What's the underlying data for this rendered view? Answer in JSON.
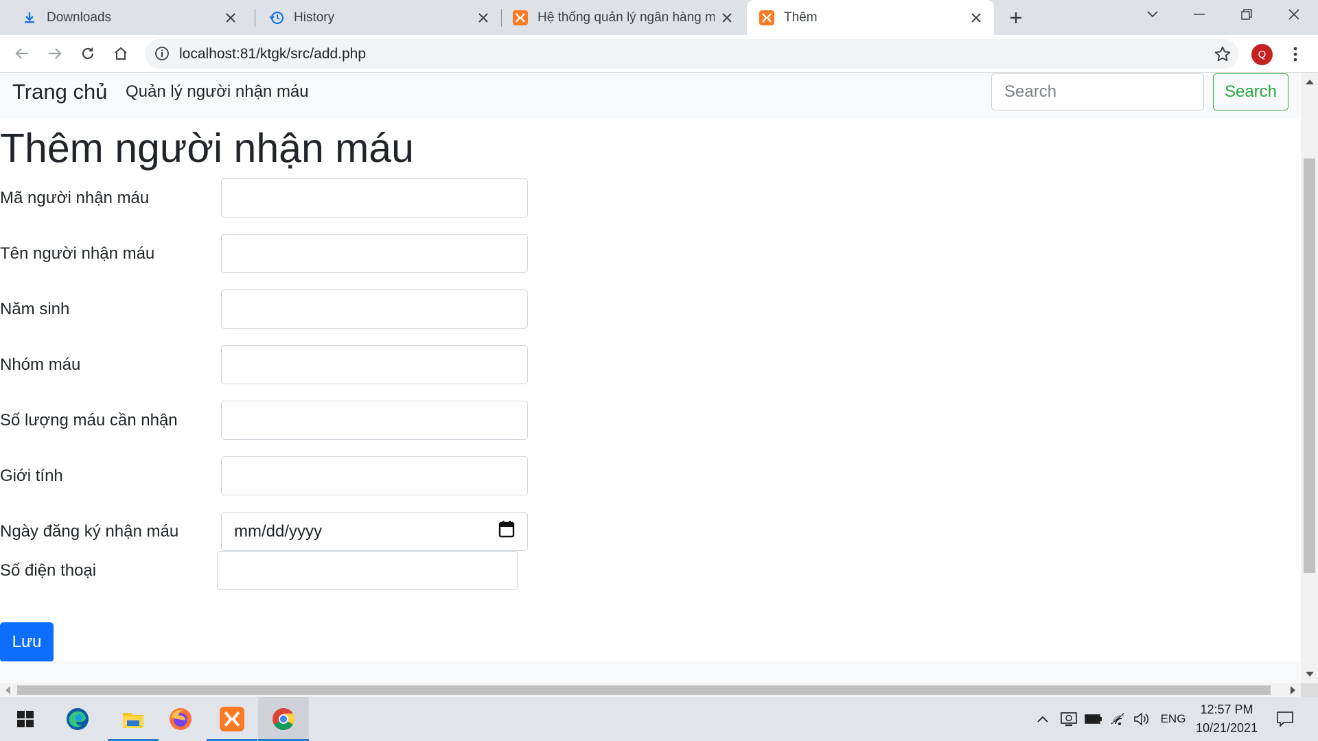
{
  "browser": {
    "tabs": [
      {
        "title": "Downloads",
        "icon": "download-icon"
      },
      {
        "title": "History",
        "icon": "history-icon"
      },
      {
        "title": "Hệ thống quản lý ngân hàng máu",
        "icon": "xampp-icon"
      },
      {
        "title": "Thêm",
        "icon": "xampp-icon",
        "active": true
      }
    ],
    "url": "localhost:81/ktgk/src/add.php",
    "profile_initial": "Q"
  },
  "navbar": {
    "brand": "Trang chủ",
    "link": "Quản lý người nhận máu",
    "search_placeholder": "Search",
    "search_button": "Search"
  },
  "page": {
    "heading": "Thêm người nhận máu",
    "fields": [
      {
        "label": "Mã người nhận máu",
        "value": ""
      },
      {
        "label": "Tên người nhận máu",
        "value": ""
      },
      {
        "label": "Năm sinh",
        "value": ""
      },
      {
        "label": "Nhóm máu",
        "value": ""
      },
      {
        "label": "Số lượng máu cần nhận",
        "value": ""
      },
      {
        "label": "Giới tính",
        "value": ""
      },
      {
        "label": "Ngày đăng ký nhận máu",
        "value": "",
        "placeholder": "mm/dd/yyyy"
      },
      {
        "label": "Số điện thoại",
        "value": ""
      }
    ],
    "save_button": "Lưu"
  },
  "colors": {
    "primary": "#0d6efd",
    "success": "#28a745",
    "navbar_bg": "#f8f9fa",
    "xampp": "#fb7a24"
  },
  "taskbar": {
    "apps": [
      "windows-start-icon",
      "edge-icon",
      "file-explorer-icon",
      "firefox-icon",
      "xampp-icon",
      "chrome-icon"
    ],
    "language": "ENG",
    "time": "12:57 PM",
    "date": "10/21/2021"
  }
}
